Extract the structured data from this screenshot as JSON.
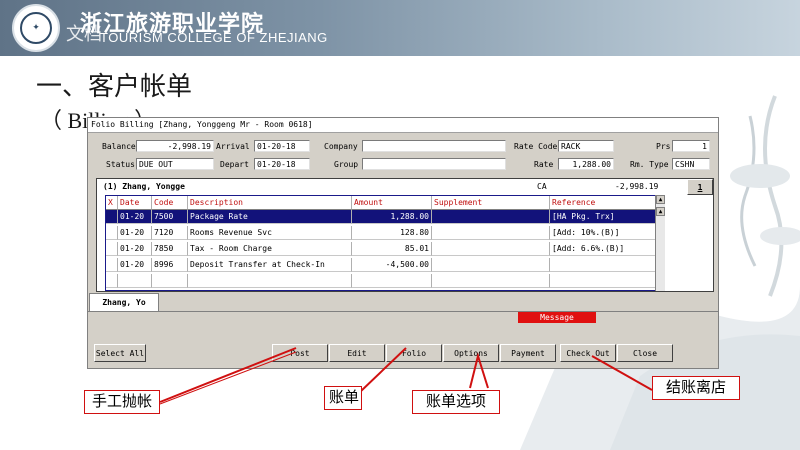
{
  "header": {
    "school_name_cn": "浙江旅游职业学院",
    "school_name_en": "TOURISM COLLEGE OF ZHEJIANG",
    "overlay_text": "文档",
    "logo_icon": "school-seal-icon"
  },
  "slide": {
    "title": "一、客户帐单",
    "subtitle": "（ Billing ）"
  },
  "window": {
    "title": "Folio Billing [Zhang, Yonggeng Mr - Room 0618]",
    "balance_label": "Balance",
    "balance_value": "-2,998.19",
    "arrival_label": "Arrival",
    "arrival_value": "01-20-18",
    "company_label": "Company",
    "company_value": "",
    "rate_code_label": "Rate Code",
    "rate_code_value": "RACK",
    "prs_label": "Prs",
    "prs_value": "1",
    "status_label": "Status",
    "status_value": "DUE OUT",
    "depart_label": "Depart",
    "depart_value": "01-20-18",
    "group_label": "Group",
    "group_value": "",
    "rate_label": "Rate",
    "rate_value": "1,288.00",
    "rm_type_label": "Rm. Type",
    "rm_type_value": "CSHN",
    "folio_header_name": "(1) Zhang, Yongge",
    "folio_header_type": "CA",
    "folio_header_balance": "-2,998.19",
    "folio_number_button": "1",
    "columns": [
      "X",
      "Date",
      "Code",
      "Description",
      "Amount",
      "Supplement",
      "Reference"
    ],
    "rows": [
      {
        "x": "",
        "date": "01-20",
        "code": "7500",
        "desc": "Package Rate",
        "amount": "1,288.00",
        "supplement": "",
        "reference": "[HA Pkg. Trx]",
        "selected": true
      },
      {
        "x": "",
        "date": "01-20",
        "code": "7120",
        "desc": "Rooms Revenue Svc",
        "amount": "128.80",
        "supplement": "",
        "reference": "[Add: 10%.(B)]",
        "selected": false
      },
      {
        "x": "",
        "date": "01-20",
        "code": "7850",
        "desc": "Tax - Room Charge",
        "amount": "85.01",
        "supplement": "",
        "reference": "[Add: 6.6%.(B)]",
        "selected": false
      },
      {
        "x": "",
        "date": "01-20",
        "code": "8996",
        "desc": "Deposit Transfer at Check-In",
        "amount": "-4,500.00",
        "supplement": "",
        "reference": "",
        "selected": false
      }
    ],
    "folio_tab": "Zhang, Yo",
    "message_label": "Message",
    "buttons": {
      "select_all": "Select All",
      "post": "Post",
      "edit": "Edit",
      "folio": "Folio",
      "options": "Options",
      "payment": "Payment",
      "check_out": "Check Out",
      "close": "Close"
    }
  },
  "callouts": {
    "manual_post": "手工抛帐",
    "folio": "账单",
    "folio_options": "账单选项",
    "check_out": "结账离店"
  },
  "colors": {
    "header_band": "#6f8498",
    "selection": "#12127a",
    "column_header_text": "#c01010",
    "message_bg": "#e01010",
    "callout_border": "#d01010"
  }
}
